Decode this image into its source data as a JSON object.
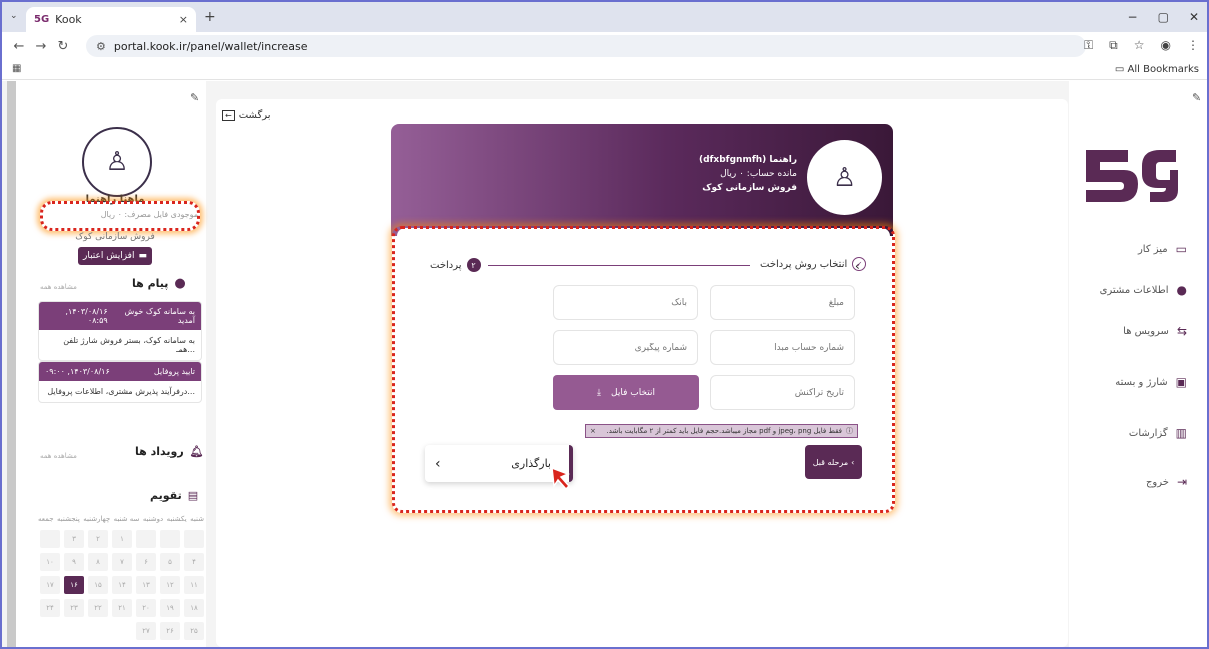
{
  "browser": {
    "tab_title": "Kook",
    "tab_favicon": "5G",
    "tab_close": "×",
    "new_tab": "+",
    "tab_list": "⌄",
    "url": "portal.kook.ir/panel/wallet/increase",
    "all_bookmarks": "All Bookmarks",
    "window_controls": [
      "−",
      "▢",
      "✕"
    ]
  },
  "left_panel": {
    "user_name": "ماهنا راهنما",
    "balance_line": "موجودی فایل مصرف: ۰ ریال",
    "company_line": "فروش سازمانی کوک",
    "increase_credit_label": "افزایش اعتبار",
    "messages": {
      "title": "پیام ها",
      "see_all": "مشاهده همه",
      "items": [
        {
          "title": "به سامانه کوک خوش آمدید",
          "date": "۱۴۰۳/۰۸/۱۶, ۰۸:۵۹",
          "body": "به سامانه کوک، بستر فروش شارژ تلفن همـ..."
        },
        {
          "title": "تایید پروفایل",
          "date": "۱۴۰۳/۰۸/۱۶, ۰۹:۰۰",
          "body": "درفرآیند پذیرش مشتری، اطلاعات پروفایل..."
        }
      ]
    },
    "events": {
      "title": "رویداد ها",
      "see_all": "مشاهده همه"
    },
    "calendar": {
      "title": "تقویم",
      "weekdays": [
        "شنبه",
        "یکشنبه",
        "دوشنبه",
        "سه شنبه",
        "چهارشنبه",
        "پنجشنبه",
        "جمعه"
      ],
      "cells": [
        "",
        "",
        "",
        "۱",
        "۲",
        "۳",
        "",
        "۴",
        "۵",
        "۶",
        "۷",
        "۸",
        "۹",
        "۱۰",
        "۱۱",
        "۱۲",
        "۱۳",
        "۱۴",
        "۱۵",
        "۱۶",
        "۱۷",
        "۱۸",
        "۱۹",
        "۲۰",
        "۲۱",
        "۲۲",
        "۲۳",
        "۲۴",
        "۲۵",
        "۲۶",
        "۲۷"
      ],
      "today": "۱۶"
    }
  },
  "main": {
    "back_label": "برگشت",
    "hero": {
      "name_line": "راهنما (dfxbfgnmfh)",
      "balance_line": "مانده حساب: ۰ ریال",
      "company_line": "فروش سازمانی کوک"
    },
    "steps": {
      "step1": "انتخاب روش پرداخت",
      "step2": "پرداخت",
      "step2_num": "۲"
    },
    "fields": {
      "amount": "مبلغ",
      "bank": "بانک",
      "source_account": "شماره حساب مبدا",
      "tracking": "شماره پیگیری",
      "transaction_date": "تاریخ تراکنش"
    },
    "file_button": "انتخاب فایل",
    "notice": "فقط فایل jpeg، png و pdf مجاز میباشد.حجم فایل باید کمتر از ۲ مگابایت باشد.",
    "prev_step": "مرحله قبل",
    "upload_panel_label": "بارگذاری"
  },
  "right_nav": {
    "items": [
      {
        "label": "میز کار",
        "icon": "laptop-icon"
      },
      {
        "label": "اطلاعات مشتری",
        "icon": "user-icon"
      },
      {
        "label": "سرویس ها",
        "icon": "services-icon"
      },
      {
        "label": "شارژ و بسته",
        "icon": "charge-icon"
      },
      {
        "label": "گزارشات",
        "icon": "chart-icon"
      },
      {
        "label": "خروج",
        "icon": "logout-icon"
      }
    ]
  },
  "colors": {
    "brand": "#5a2a55",
    "highlight": "#d9251d"
  }
}
